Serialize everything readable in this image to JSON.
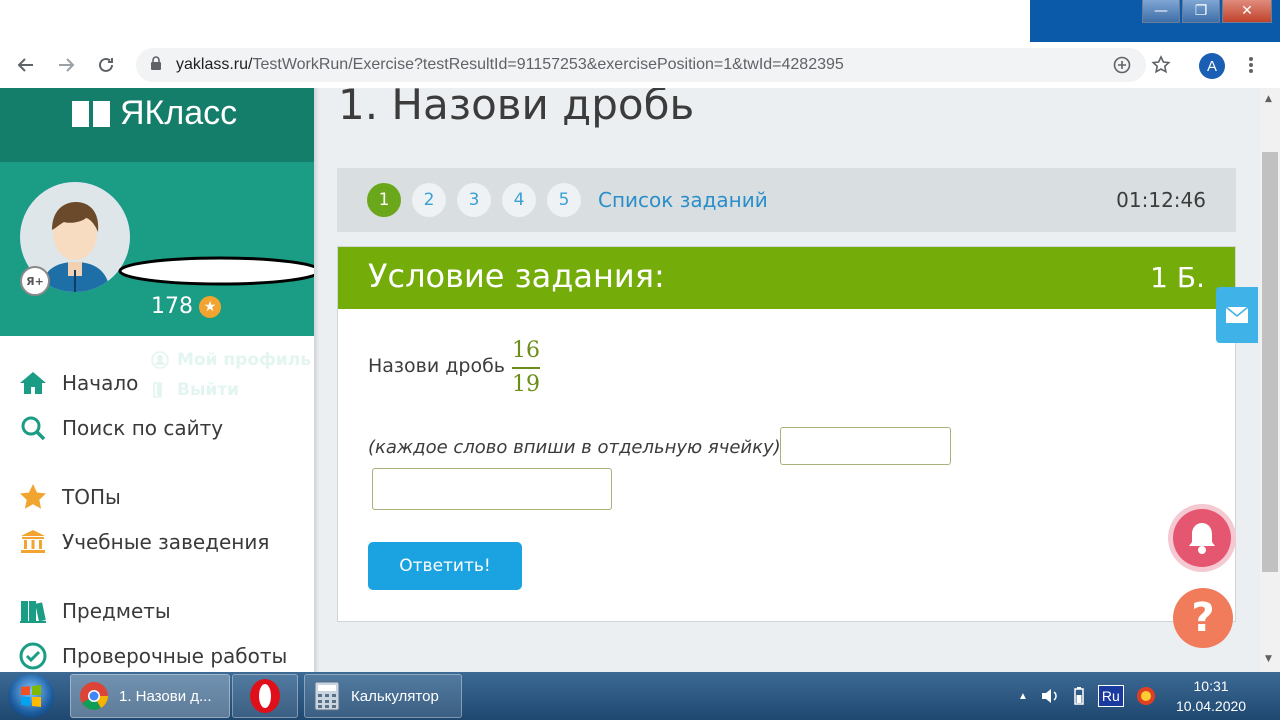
{
  "browser": {
    "url_host": "yaklass.ru/",
    "url_path": "TestWorkRun/Exercise?testResultId=91157253&exercisePosition=1&twId=4282395",
    "profile_initial": "A",
    "window_buttons": {
      "minimize": "—",
      "maximize": "❐",
      "close": "✕"
    }
  },
  "sidebar": {
    "logo": "ЯКласс",
    "score": "178",
    "profile_link": "Мой профиль",
    "logout_link": "Выйти",
    "badge": "Я+",
    "menu": [
      {
        "label": "Начало",
        "icon": "home-icon"
      },
      {
        "label": "Поиск по сайту",
        "icon": "search-icon"
      },
      {
        "label": "ТОПы",
        "icon": "star-icon"
      },
      {
        "label": "Учебные заведения",
        "icon": "institution-icon"
      },
      {
        "label": "Предметы",
        "icon": "books-icon"
      },
      {
        "label": "Проверочные работы",
        "icon": "check-circle-icon"
      }
    ]
  },
  "main": {
    "title": "1. Назови дробь",
    "task_numbers": [
      "1",
      "2",
      "3",
      "4",
      "5"
    ],
    "active_task": "1",
    "task_list_link": "Список заданий",
    "timer": "01:12:46",
    "card_title": "Условие задания:",
    "points": "1 Б.",
    "question": "Назови дробь",
    "fraction_numerator": "16",
    "fraction_denominator": "19",
    "hint": "(каждое слово впиши в отдельную ячейку)",
    "answer_1": "",
    "answer_2": "",
    "submit_label": "Ответить!",
    "help_label": "?"
  },
  "taskbar": {
    "chrome_tab": "1. Назови д...",
    "calculator": "Калькулятор",
    "language": "Ru",
    "time": "10:31",
    "date": "10.04.2020"
  },
  "colors": {
    "logo_bg": "#157e6b",
    "user_bg": "#1b9c85",
    "card_header": "#74ac0a",
    "accent_blue": "#1aa3e0",
    "active_task": "#6aa71b"
  }
}
